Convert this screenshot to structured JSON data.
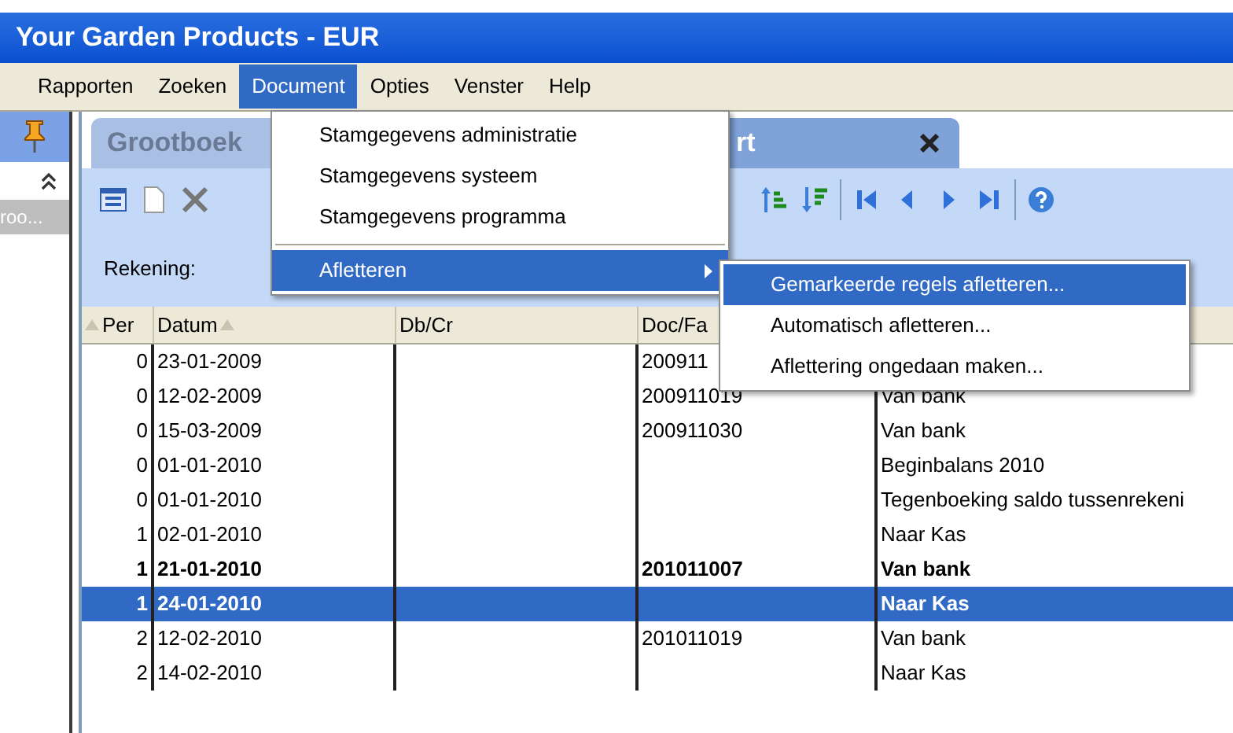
{
  "window": {
    "title": "Your Garden Products - EUR"
  },
  "menu_bar": [
    {
      "label": "Rapporten",
      "selected": false
    },
    {
      "label": "Zoeken",
      "selected": false
    },
    {
      "label": "Document",
      "selected": true
    },
    {
      "label": "Opties",
      "selected": false
    },
    {
      "label": "Venster",
      "selected": false
    },
    {
      "label": "Help",
      "selected": false
    }
  ],
  "document_menu": [
    {
      "label": "Stamgegevens administratie",
      "kind": "item",
      "selected": false
    },
    {
      "label": "Stamgegevens systeem",
      "kind": "item",
      "selected": false
    },
    {
      "label": "Stamgegevens programma",
      "kind": "item",
      "selected": false
    },
    {
      "kind": "separator"
    },
    {
      "label": "Afletteren",
      "kind": "submenu",
      "selected": true
    }
  ],
  "afletteren_submenu": [
    {
      "label": "Gemarkeerde regels afletteren...",
      "selected": true
    },
    {
      "label": "Automatisch afletteren...",
      "selected": false
    },
    {
      "label": "Aflettering ongedaan maken...",
      "selected": false
    }
  ],
  "side_panel": {
    "item": "roo..."
  },
  "tabs": [
    {
      "label": "Grootboek",
      "selected": false
    },
    {
      "label": "rt",
      "selected": true
    }
  ],
  "filter": {
    "label": "Rekening:"
  },
  "table": {
    "columns": [
      {
        "label": "Per",
        "sort": true
      },
      {
        "label": "Datum",
        "sort": true
      },
      {
        "label": "Db/Cr",
        "sort": false
      },
      {
        "label": "Doc/Fa",
        "sort": false
      }
    ],
    "rows": [
      {
        "per": "0",
        "datum": "23-01-2009",
        "dbcr": "",
        "doc": "200911",
        "omschrijving": "",
        "bold": false,
        "selected": false
      },
      {
        "per": "0",
        "datum": "12-02-2009",
        "dbcr": "",
        "doc": "200911019",
        "omschrijving": "Van bank",
        "bold": false,
        "selected": false
      },
      {
        "per": "0",
        "datum": "15-03-2009",
        "dbcr": "",
        "doc": "200911030",
        "omschrijving": "Van bank",
        "bold": false,
        "selected": false
      },
      {
        "per": "0",
        "datum": "01-01-2010",
        "dbcr": "",
        "doc": "",
        "omschrijving": "Beginbalans 2010",
        "bold": false,
        "selected": false
      },
      {
        "per": "0",
        "datum": "01-01-2010",
        "dbcr": "",
        "doc": "",
        "omschrijving": "Tegenboeking saldo tussenrekeni",
        "bold": false,
        "selected": false
      },
      {
        "per": "1",
        "datum": "02-01-2010",
        "dbcr": "",
        "doc": "",
        "omschrijving": "Naar Kas",
        "bold": false,
        "selected": false
      },
      {
        "per": "1",
        "datum": "21-01-2010",
        "dbcr": "",
        "doc": "201011007",
        "omschrijving": "Van bank",
        "bold": true,
        "selected": false
      },
      {
        "per": "1",
        "datum": "24-01-2010",
        "dbcr": "",
        "doc": "",
        "omschrijving": "Naar Kas",
        "bold": true,
        "selected": true
      },
      {
        "per": "2",
        "datum": "12-02-2010",
        "dbcr": "",
        "doc": "201011019",
        "omschrijving": "Van bank",
        "bold": false,
        "selected": false
      },
      {
        "per": "2",
        "datum": "14-02-2010",
        "dbcr": "",
        "doc": "",
        "omschrijving": "Naar Kas",
        "bold": false,
        "selected": false
      }
    ]
  }
}
